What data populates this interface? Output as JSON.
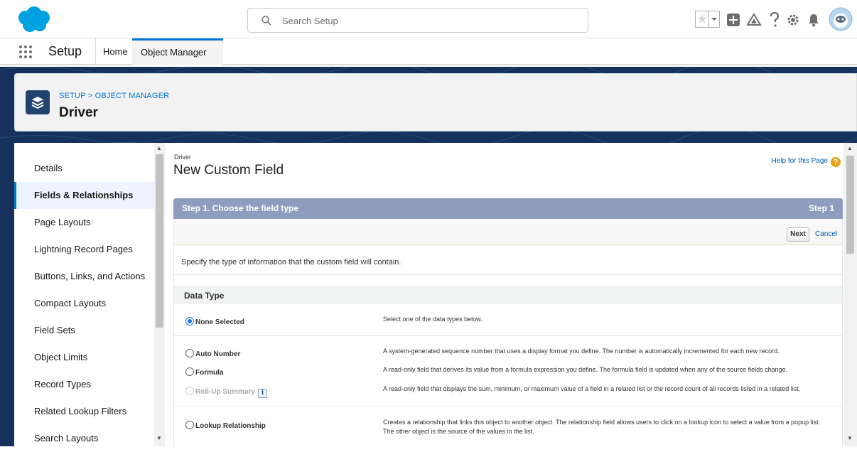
{
  "search": {
    "placeholder": "Search Setup"
  },
  "icons": {
    "logo": "salesforce-cloud-logo",
    "favorites": "star-icon",
    "add": "plus-icon",
    "trailhead": "trailhead-icon",
    "help": "question-icon",
    "settings": "gear-icon",
    "notifications": "bell-icon",
    "avatar": "astro-avatar"
  },
  "nav": {
    "app_title": "Setup",
    "tabs": [
      {
        "label": "Home"
      },
      {
        "label": "Object Manager"
      }
    ]
  },
  "header": {
    "breadcrumb": "SETUP > OBJECT MANAGER",
    "object_name": "Driver"
  },
  "sidebar": {
    "items": [
      {
        "label": "Details"
      },
      {
        "label": "Fields & Relationships"
      },
      {
        "label": "Page Layouts"
      },
      {
        "label": "Lightning Record Pages"
      },
      {
        "label": "Buttons, Links, and Actions"
      },
      {
        "label": "Compact Layouts"
      },
      {
        "label": "Field Sets"
      },
      {
        "label": "Object Limits"
      },
      {
        "label": "Record Types"
      },
      {
        "label": "Related Lookup Filters"
      },
      {
        "label": "Search Layouts"
      }
    ],
    "active_index": 1
  },
  "main": {
    "crumb": "Driver",
    "title": "New Custom Field",
    "help_link": "Help for this Page",
    "step_title": "Step 1. Choose the field type",
    "step_label": "Step 1",
    "next_label": "Next",
    "cancel_label": "Cancel",
    "instructions": "Specify the type of information that the custom field will contain.",
    "data_type_header": "Data Type",
    "options": [
      {
        "label": "None Selected",
        "selected": true,
        "disabled": false,
        "description": "Select one of the data types below."
      },
      {
        "label": "Auto Number",
        "selected": false,
        "disabled": false,
        "description": "A system-generated sequence number that uses a display format you define. The number is automatically incremented for each new record."
      },
      {
        "label": "Formula",
        "selected": false,
        "disabled": false,
        "description": "A read-only field that derives its value from a formula expression you define. The formula field is updated when any of the source fields change."
      },
      {
        "label": "Roll-Up Summary",
        "selected": false,
        "disabled": true,
        "description": "A read-only field that displays the sum, minimum, or maximum value of a field in a related list or the record count of all records listed in a related list."
      },
      {
        "label": "Lookup Relationship",
        "selected": false,
        "disabled": false,
        "description": "Creates a relationship that links this object to another object. The relationship field allows users to click on a lookup icon to select a value from a popup list. The other object is the source of the values in the list."
      }
    ]
  },
  "colors": {
    "brand_blue": "#00a1e0",
    "accent": "#0176d3",
    "step_header": "#8e9dbe",
    "background": "#16325c"
  }
}
